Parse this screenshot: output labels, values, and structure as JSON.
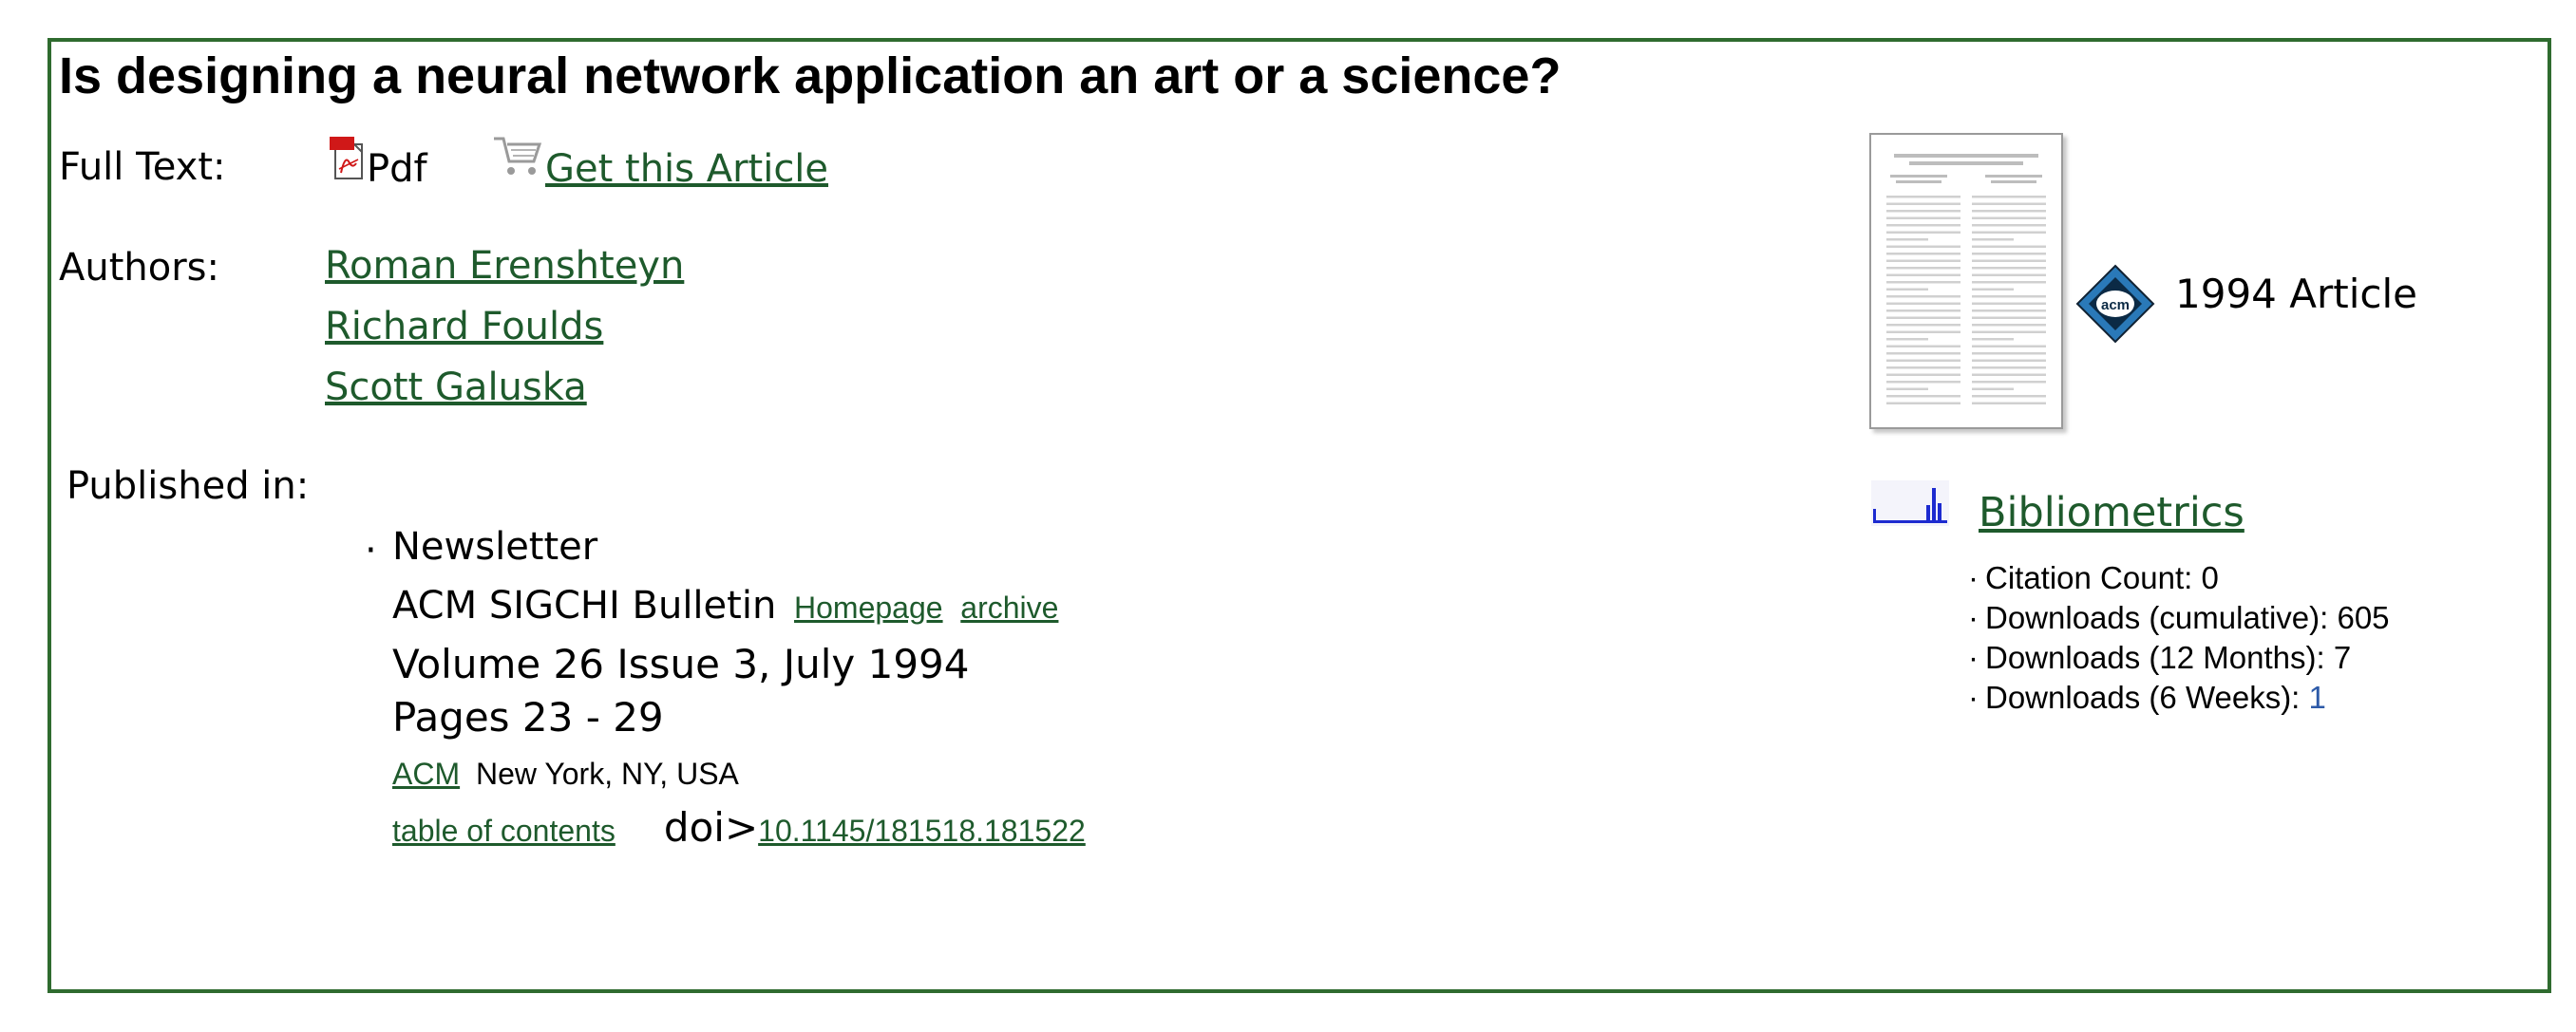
{
  "article": {
    "title": "Is designing a neural network application an art or a science?",
    "full_text_label": "Full Text:",
    "pdf_label": "Pdf",
    "get_article_label": "Get this Article",
    "authors_label": "Authors:",
    "authors": [
      "Roman Erenshteyn",
      "Richard Foulds",
      "Scott Galuska"
    ],
    "published_in_label": "Published in:"
  },
  "publication": {
    "bullet": "·",
    "type": "Newsletter",
    "name": "ACM SIGCHI Bulletin",
    "homepage_link": "Homepage",
    "archive_link": "archive",
    "volume": "Volume 26 Issue 3, July 1994",
    "pages": "Pages 23 - 29",
    "publisher_link": "ACM",
    "location": "New York, NY, USA",
    "toc_link": "table of contents",
    "doi_label": "doi>",
    "doi_link": "10.1145/181518.181522"
  },
  "sidebar": {
    "year_type": "1994 Article",
    "bibliometrics_link": "Bibliometrics",
    "stats": [
      {
        "label": "Citation Count: 0",
        "value": ""
      },
      {
        "label": "Downloads (cumulative): 605",
        "value": ""
      },
      {
        "label": "Downloads (12 Months): 7",
        "value": ""
      },
      {
        "label": "Downloads (6 Weeks): ",
        "value": "1"
      }
    ]
  },
  "colors": {
    "frame_border": "#2f6b2f",
    "link": "#1e5a2c",
    "stat_value": "#2d5aa8"
  },
  "icons": [
    "pdf-icon",
    "shopping-cart-icon",
    "acm-logo-icon",
    "bibliometrics-chart-icon"
  ]
}
